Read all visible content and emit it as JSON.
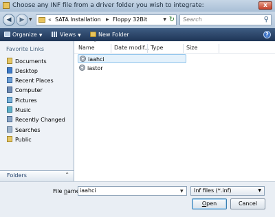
{
  "window": {
    "title": "Choose any INF file from a driver folder you wish to integrate:",
    "close_glyph": "x"
  },
  "address": {
    "chevron": "«",
    "crumbs": [
      "SATA Installation",
      "Floppy 32Bit"
    ],
    "separator": "▶",
    "search_placeholder": "Search"
  },
  "toolbar": {
    "organize_label": "Organize",
    "views_label": "Views",
    "new_folder_label": "New Folder",
    "help_glyph": "?"
  },
  "sidebar": {
    "header": "Favorite Links",
    "items": [
      {
        "label": "Documents",
        "icon": "documents-icon"
      },
      {
        "label": "Desktop",
        "icon": "desktop-icon"
      },
      {
        "label": "Recent Places",
        "icon": "recent-places-icon"
      },
      {
        "label": "Computer",
        "icon": "computer-icon"
      },
      {
        "label": "Pictures",
        "icon": "pictures-icon"
      },
      {
        "label": "Music",
        "icon": "music-icon"
      },
      {
        "label": "Recently Changed",
        "icon": "recently-changed-icon"
      },
      {
        "label": "Searches",
        "icon": "searches-icon"
      },
      {
        "label": "Public",
        "icon": "public-icon"
      }
    ],
    "folders_label": "Folders"
  },
  "filelist": {
    "columns": [
      "Name",
      "Date modif...",
      "Type",
      "Size"
    ],
    "files": [
      {
        "name": "iaahci",
        "selected": true,
        "icon": "inf-file-icon"
      },
      {
        "name": "iastor",
        "selected": false,
        "icon": "inf-file-icon"
      }
    ]
  },
  "bottom": {
    "filename_label_pre": "File ",
    "filename_label_u": "n",
    "filename_label_post": "ame:",
    "filename_value": "iaahci",
    "filter_value": "Inf files (*.inf)",
    "open_u": "O",
    "open_rest": "pen",
    "cancel_label": "Cancel"
  }
}
